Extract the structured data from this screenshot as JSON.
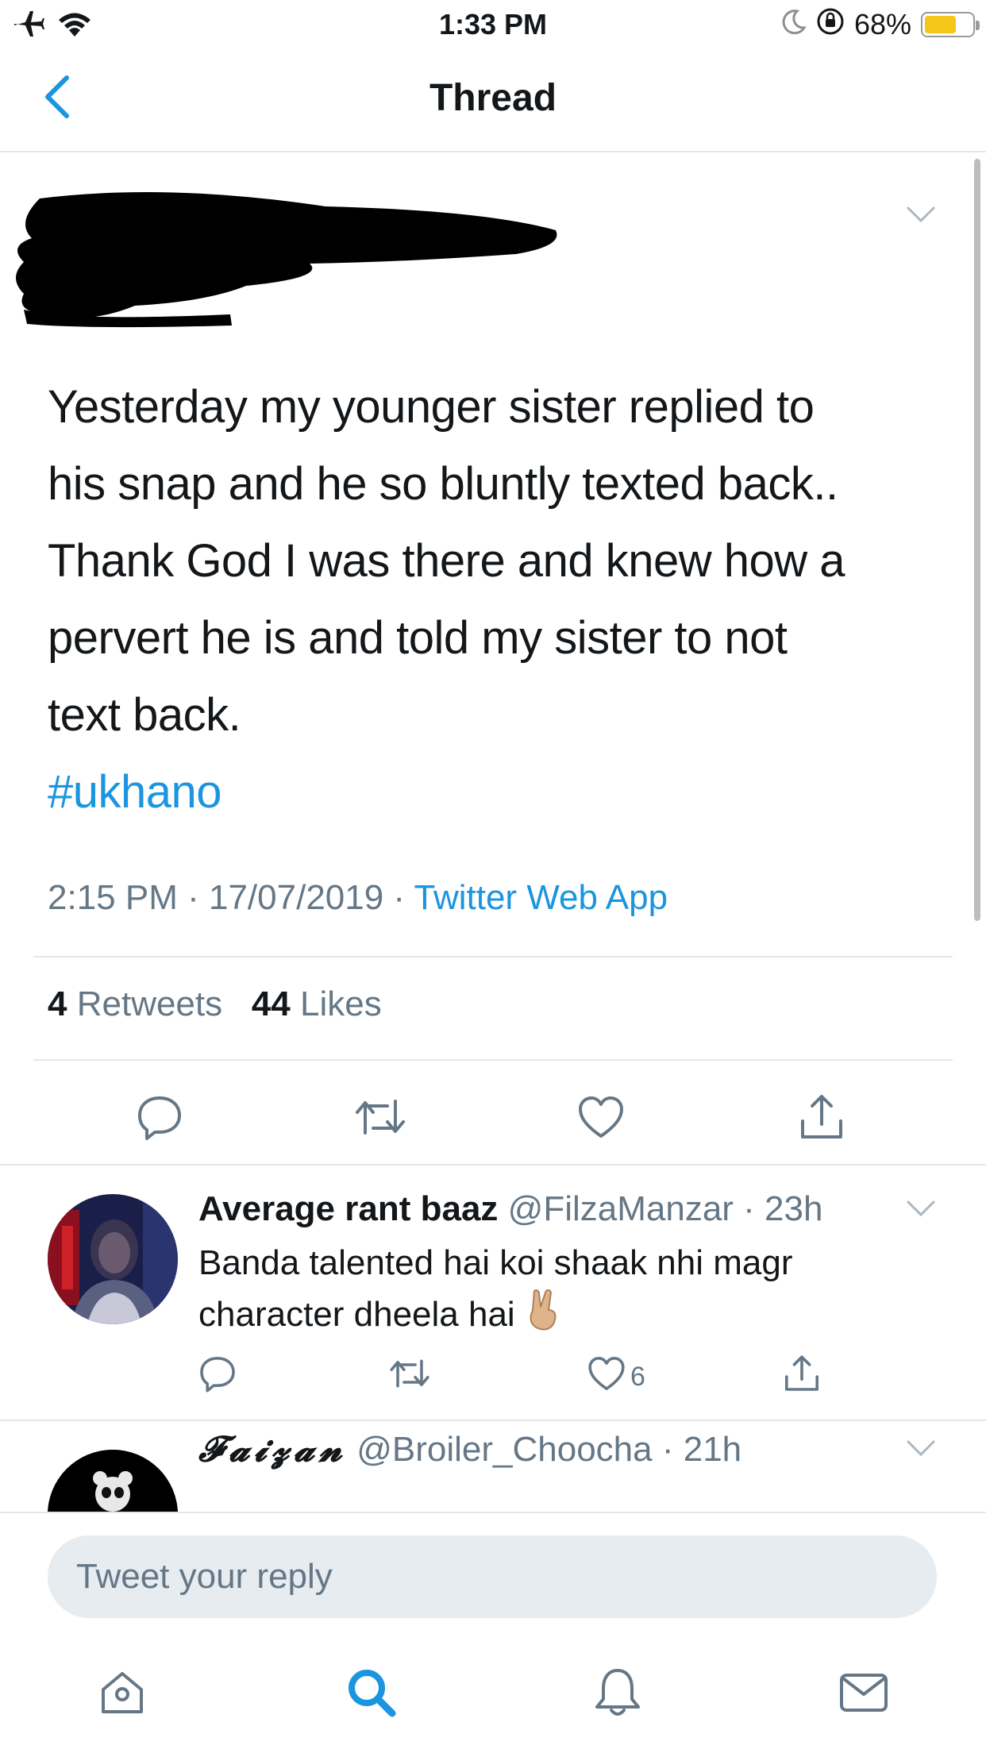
{
  "status_bar": {
    "time": "1:33 PM",
    "battery_percent": "68%",
    "battery_level": 0.68,
    "icons": [
      "airplane-icon",
      "wifi-icon",
      "moon-icon",
      "orientation-lock-icon",
      "battery-icon"
    ]
  },
  "nav": {
    "title": "Thread",
    "back_icon": "chevron-left-icon"
  },
  "main_tweet": {
    "author_redacted": true,
    "text_lines": [
      "Yesterday my younger sister replied to",
      "his snap and he so bluntly texted back..",
      "Thank God I was there and knew how a",
      "pervert he is and told my sister to not",
      "text back."
    ],
    "hashtag": "#ukhano",
    "time": "2:15 PM",
    "separator": " · ",
    "date": "17/07/2019",
    "source": "Twitter Web App",
    "retweets_count": "4",
    "retweets_label": "Retweets",
    "likes_count": "44",
    "likes_label": "Likes"
  },
  "replies": [
    {
      "name": "Average rant baaz",
      "handle": "@FilzaManzar",
      "time": "23h",
      "text_line1": "Banda talented hai koi shaak nhi magr",
      "text_line2": "character dheela hai",
      "emoji": "victory-hand-icon",
      "like_count": "6"
    },
    {
      "name": "𝓕𝓪𝓲𝔃𝓪𝓷",
      "handle": "@Broiler_Choocha",
      "time": "21h"
    }
  ],
  "composer": {
    "placeholder": "Tweet your reply"
  },
  "tab_bar": {
    "tabs": [
      "home-icon",
      "search-icon",
      "notifications-icon",
      "messages-icon"
    ],
    "active": "search-icon"
  },
  "colors": {
    "accent": "#1b95e0",
    "text": "#14171a",
    "secondary": "#657786",
    "divider": "#e1e8ed",
    "battery": "#f5c518",
    "input_bg": "#e6ecf0"
  }
}
